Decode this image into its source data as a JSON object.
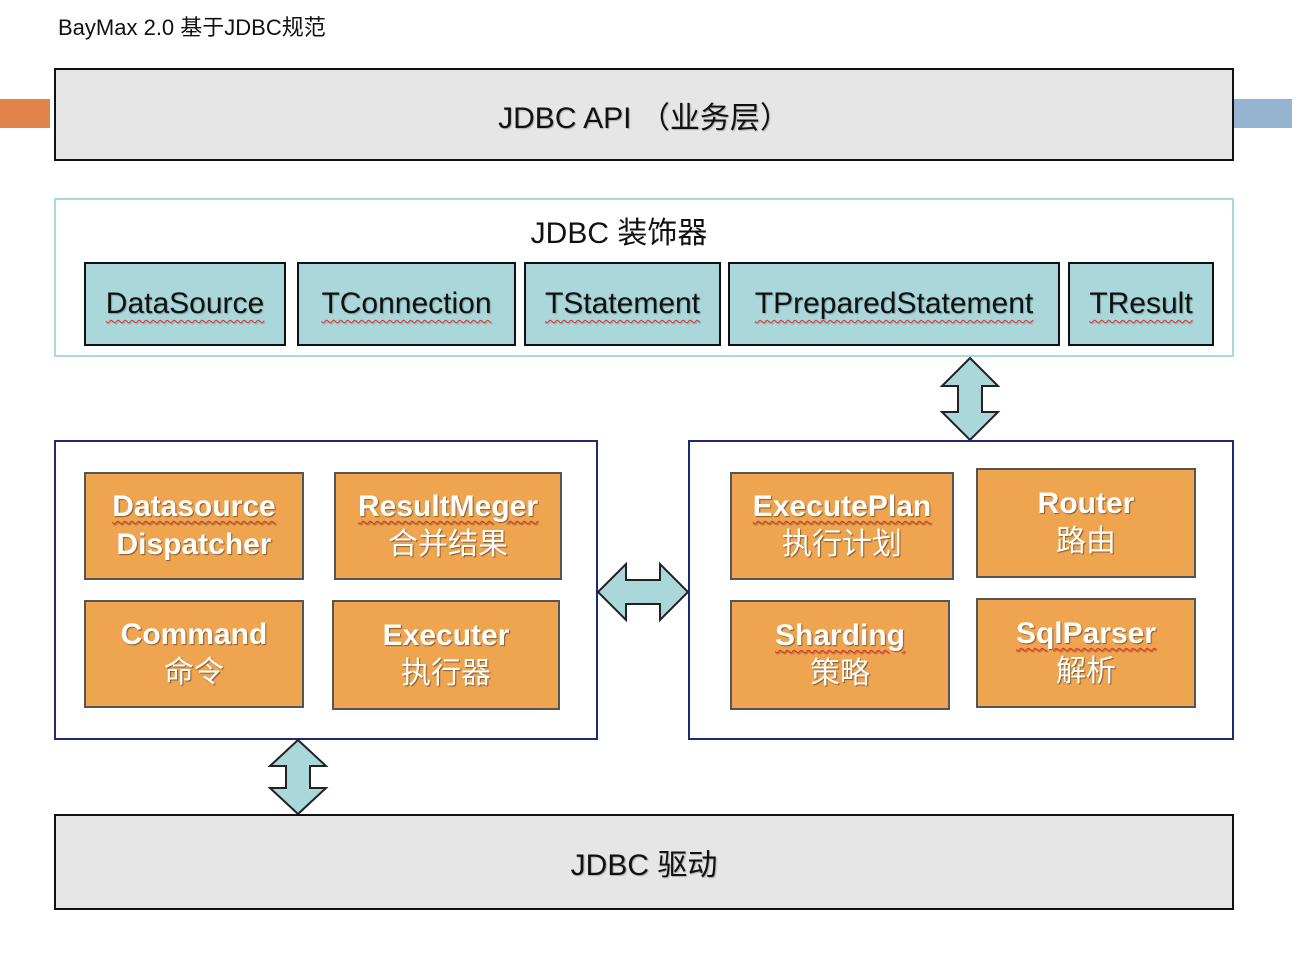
{
  "title": "BayMax 2.0 基于JDBC规范",
  "api_layer": {
    "label": "JDBC API （业务层）"
  },
  "decorator": {
    "title": "JDBC 装饰器",
    "items": [
      {
        "label": "DataSource"
      },
      {
        "label": "TConnection"
      },
      {
        "label": "TStatement"
      },
      {
        "label": "TPreparedStatement"
      },
      {
        "label": "TResult"
      }
    ]
  },
  "left_group": {
    "items": [
      {
        "en": "Datasource",
        "en2": "Dispatcher",
        "zh": ""
      },
      {
        "en": "ResultMeger",
        "zh": "合并结果"
      },
      {
        "en": "Command",
        "zh": "命令"
      },
      {
        "en": "Executer",
        "zh": "执行器"
      }
    ]
  },
  "right_group": {
    "items": [
      {
        "en": "ExecutePlan",
        "zh": "执行计划"
      },
      {
        "en": "Router",
        "zh": "路由"
      },
      {
        "en": "Sharding",
        "zh": "策略"
      },
      {
        "en": "SqlParser",
        "zh": "解析"
      }
    ]
  },
  "driver_layer": {
    "label": "JDBC 驱动"
  },
  "colors": {
    "layer_fill": "#e6e6e6",
    "teal": "#a9d7da",
    "orange": "#efa44f",
    "navy_border": "#1c2c6e",
    "accent_left": "#e0824a",
    "accent_right": "#94b4d0"
  }
}
